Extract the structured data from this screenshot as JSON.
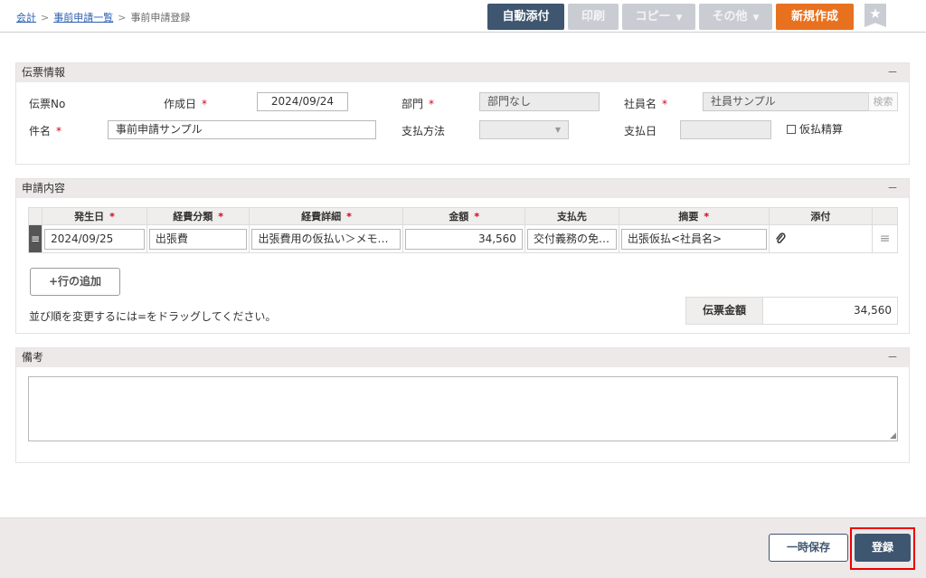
{
  "breadcrumb": {
    "items": [
      "会計",
      "事前申請一覧"
    ],
    "separator": ">",
    "current": "事前申請登録"
  },
  "toolbar": {
    "auto_attach": "自動添付",
    "print": "印刷",
    "copy": "コピー",
    "other": "その他",
    "new": "新規作成",
    "caret": "▼",
    "star": "★"
  },
  "colors": {
    "primary": "#3e5670",
    "accent": "#e8711f",
    "disabled": "#c9cdd3",
    "required": "#d0021b",
    "highlight": "#ee0000"
  },
  "voucher_info": {
    "title": "伝票情報",
    "collapse": "－",
    "voucher_no_label": "伝票No",
    "created_label": "作成日",
    "created_value": "2024/09/24",
    "dept_label": "部門",
    "dept_value": "部門なし",
    "employee_label": "社員名",
    "employee_value": "社員サンプル",
    "search_label": "検索",
    "subject_label": "件名",
    "subject_value": "事前申請サンプル",
    "payment_method_label": "支払方法",
    "payment_method_value": "",
    "payment_date_label": "支払日",
    "payment_date_value": "",
    "provisional_label": "仮払精算",
    "required_mark": "*"
  },
  "application": {
    "title": "申請内容",
    "collapse": "－",
    "columns": [
      "発生日",
      "経費分類",
      "経費詳細",
      "金額",
      "支払先",
      "摘要",
      "添付"
    ],
    "required_cols": [
      true,
      true,
      true,
      true,
      false,
      true,
      false
    ],
    "rows": [
      {
        "handle": "≡",
        "date": "2024/09/25",
        "category": "出張費",
        "detail": "出張費用の仮払い＞メモ…",
        "amount": "34,560",
        "payee": "交付義務の免…",
        "summary": "出張仮払<社員名>",
        "attach_icon": "paperclip-icon",
        "row_handle": "≡"
      }
    ],
    "add_row": "+行の追加",
    "hint": "並び順を変更するには=をドラッグしてください。",
    "total_label": "伝票金額",
    "total_value": "34,560"
  },
  "remarks": {
    "title": "備考",
    "collapse": "－",
    "value": ""
  },
  "footer": {
    "temp_save": "一時保存",
    "register": "登録"
  }
}
